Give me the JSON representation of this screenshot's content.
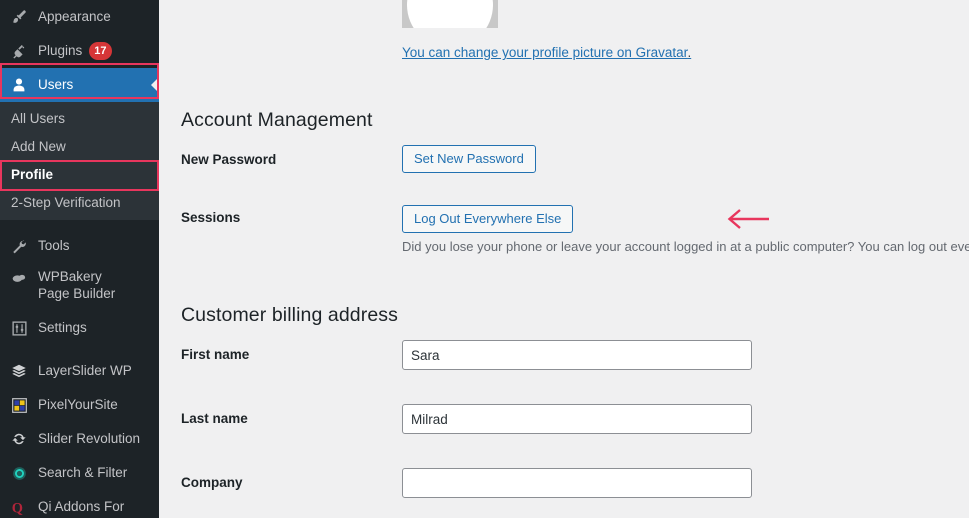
{
  "sidebar": {
    "items": [
      {
        "label": "Appearance",
        "icon": "paintbrush-icon",
        "badge": null
      },
      {
        "label": "Plugins",
        "icon": "plug-icon",
        "badge": "17"
      },
      {
        "label": "Users",
        "icon": "user-icon",
        "badge": null,
        "current": true
      },
      {
        "label": "Tools",
        "icon": "wrench-icon",
        "badge": null
      },
      {
        "label": "WPBakery Page Builder",
        "icon": "cloud-icon",
        "badge": null
      },
      {
        "label": "Settings",
        "icon": "sliders-icon",
        "badge": null
      },
      {
        "label": "LayerSlider WP",
        "icon": "layers-icon",
        "badge": null
      },
      {
        "label": "PixelYourSite",
        "icon": "grid-squares-icon",
        "badge": null
      },
      {
        "label": "Slider Revolution",
        "icon": "refresh-circle-icon",
        "badge": null
      },
      {
        "label": "Search & Filter",
        "icon": "target-circle-icon",
        "badge": null
      },
      {
        "label": "Qi Addons For",
        "icon": "qi-letter-icon",
        "badge": null
      }
    ],
    "submenu": [
      {
        "label": "All Users",
        "active": false
      },
      {
        "label": "Add New",
        "active": false
      },
      {
        "label": "Profile",
        "active": true
      },
      {
        "label": "2-Step Verification",
        "active": false
      }
    ]
  },
  "profile": {
    "gravatar_link_text": "You can change your profile picture on Gravatar",
    "gravatar_link_suffix": "."
  },
  "account_management": {
    "title": "Account Management",
    "new_password_label": "New Password",
    "set_new_password_button": "Set New Password",
    "sessions_label": "Sessions",
    "log_out_everywhere_button": "Log Out Everywhere Else",
    "sessions_help": "Did you lose your phone or leave your account logged in at a public computer? You can log out everywhere else, and stay logged in here."
  },
  "billing": {
    "title": "Customer billing address",
    "fields": [
      {
        "label": "First name",
        "value": "Sara"
      },
      {
        "label": "Last name",
        "value": "Milrad"
      },
      {
        "label": "Company",
        "value": ""
      }
    ]
  },
  "annotations": {
    "highlight_color": "#e8365d",
    "arrow_color": "#e8365d",
    "arrow_direction": "left",
    "arrow_points_to": "Log Out Everywhere Else"
  }
}
